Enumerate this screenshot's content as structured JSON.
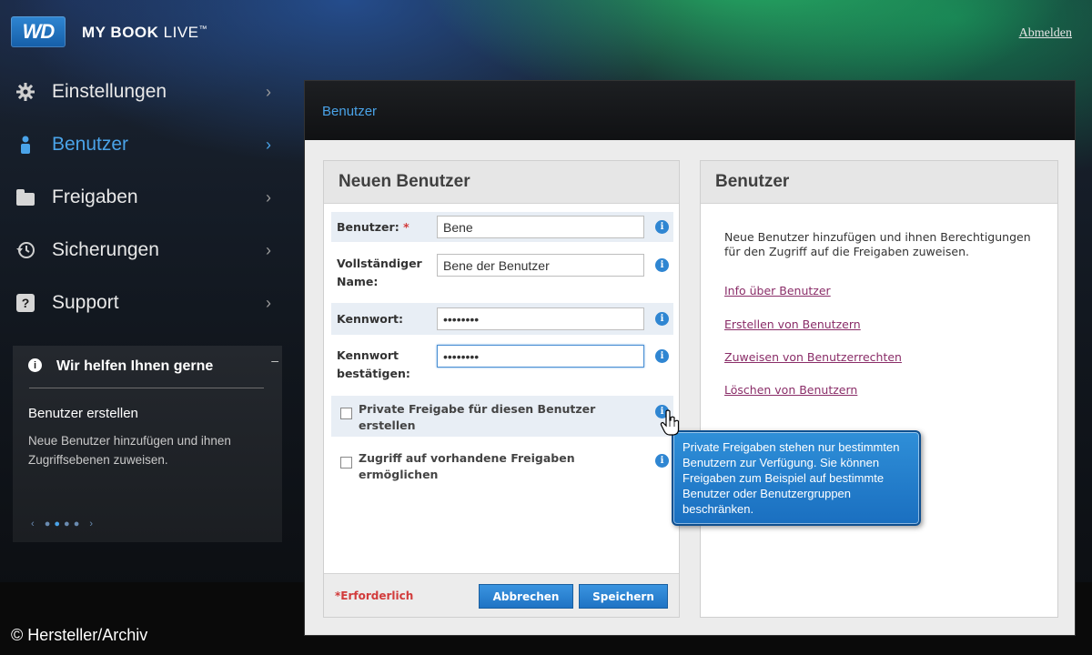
{
  "topbar": {
    "logo_text": "WD",
    "product_name": "MY BOOK",
    "product_suffix": "LIVE",
    "tm": "™",
    "logout_label": "Abmelden"
  },
  "nav": {
    "items": [
      {
        "label": "Einstellungen",
        "icon": "gear-icon",
        "chevron": "›"
      },
      {
        "label": "Benutzer",
        "icon": "user-icon",
        "chevron": "›",
        "active": true
      },
      {
        "label": "Freigaben",
        "icon": "folder-icon",
        "chevron": "›"
      },
      {
        "label": "Sicherungen",
        "icon": "backup-clock-icon",
        "chevron": "›"
      },
      {
        "label": "Support",
        "icon": "question-icon",
        "icon_glyph": "?",
        "chevron": "›"
      }
    ]
  },
  "help": {
    "title": "Wir helfen Ihnen gerne",
    "info_glyph": "i",
    "minimize": "–",
    "subtitle": "Benutzer erstellen",
    "body": "Neue Benutzer hinzufügen und ihnen Zugriffsebenen zuweisen.",
    "pager_prev": "‹",
    "pager_next": "›"
  },
  "copyright": "© Hersteller/Archiv",
  "main": {
    "title": "Benutzer"
  },
  "form": {
    "title": "Neuen Benutzer",
    "user_label": "Benutzer:",
    "required_mark": "*",
    "user_value": "Bene",
    "fullname_label_1": "Vollständiger",
    "fullname_label_2": "Name:",
    "fullname_value": "Bene der Benutzer",
    "password_label": "Kennwort:",
    "password_value": "••••••••",
    "confirm_label_1": "Kennwort",
    "confirm_label_2": "bestätigen:",
    "confirm_value": "••••••••",
    "private_share_label": "Private Freigabe für diesen Benutzer erstellen",
    "access_shares_label": "Zugriff auf vorhandene Freigaben ermöglichen",
    "info_glyph": "i",
    "required_note": "*Erforderlich",
    "cancel_label": "Abbrechen",
    "save_label": "Speichern"
  },
  "users_panel": {
    "title": "Benutzer",
    "description": "Neue Benutzer hinzufügen und ihnen Berechtigungen für den Zugriff auf die Freigaben zuweisen.",
    "links": [
      "Info über Benutzer",
      "Erstellen von Benutzern",
      "Zuweisen von Benutzerrechten",
      "Löschen von Benutzern"
    ]
  },
  "tooltip": {
    "text": "Private Freigaben stehen nur bestimmten Benutzern zur Verfügung. Sie können Freigaben zum Beispiel auf bestimmte Benutzer oder Benutzergruppen beschränken."
  },
  "colors": {
    "accent": "#4aa3e8",
    "button": "#1f73c4",
    "link": "#8a2d68",
    "required": "#d23b3b"
  }
}
